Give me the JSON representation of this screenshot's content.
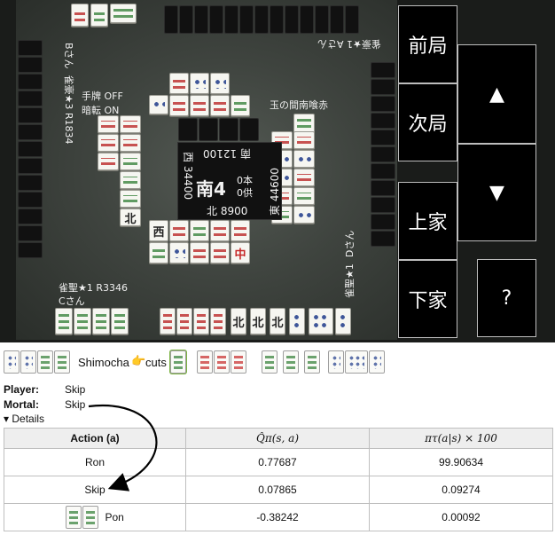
{
  "board": {
    "controls": {
      "prev_round": "前局",
      "next_round": "次局",
      "up": "▲",
      "down": "▼",
      "kamicha": "上家",
      "shimocha": "下家",
      "help": "?"
    },
    "center": {
      "round": "南4",
      "honba": "0本",
      "kyotaku": "0供",
      "south_score": "南 12100",
      "west_score": "西 34400",
      "east_score": "東 44600",
      "north_score": "北 8900"
    },
    "players": {
      "top_name": "Aさん",
      "top_rank": "雀豪★1",
      "left_name": "Bさん",
      "left_rank": "雀豪★3 R1834",
      "bottom_name": "Cさん",
      "bottom_rank": "雀聖★1 R3346",
      "right_name": "Dさん",
      "right_rank": "雀聖★1"
    },
    "options": {
      "tsumogiri": "手牌 OFF",
      "ankan": "暗転 ON"
    },
    "room_label": "玉の間南喰赤"
  },
  "turn": {
    "actor": "Shimocha",
    "pointer_emoji": "👉",
    "verb": "cuts"
  },
  "player_label": "Player:",
  "player_value": "Skip",
  "mortal_label": "Mortal:",
  "mortal_value": "Skip",
  "details_label": "▾ Details",
  "table": {
    "headers": [
      "Action (a)",
      "Q̂π(s, a)",
      "πτ(a|s) × 100"
    ],
    "rows": [
      {
        "action": "Ron",
        "q": "0.77687",
        "pi": "99.90634"
      },
      {
        "action": "Skip",
        "q": "0.07865",
        "pi": "0.09274"
      },
      {
        "action": "Pon",
        "q": "-0.38242",
        "pi": "0.00092"
      }
    ]
  },
  "colors": {
    "board_bg": "#3f443f",
    "button_bg": "#000000",
    "arrow": "#000000"
  }
}
